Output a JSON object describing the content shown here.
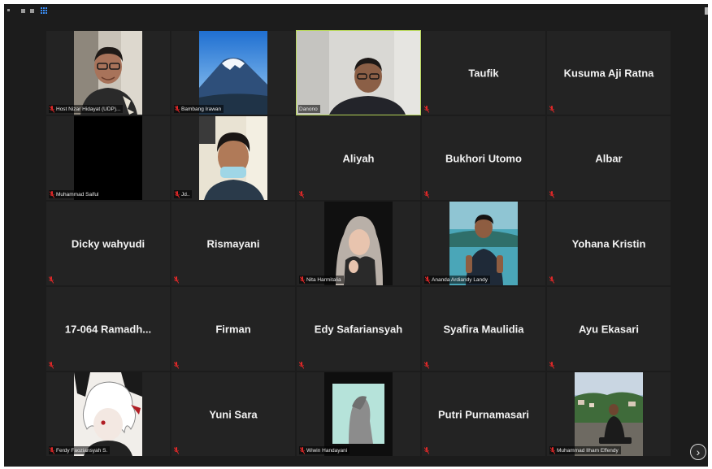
{
  "participants": [
    {
      "name": "Host Nizar Hidayat (UDP)",
      "mode": "video",
      "label": "Host Nizar Hidayat (UDP)..."
    },
    {
      "name": "Bambang Irawan",
      "mode": "video",
      "label": "Bambang Irawan"
    },
    {
      "name": "Danono",
      "mode": "video",
      "label": "Danono",
      "active": true
    },
    {
      "name": "Taufik",
      "mode": "name"
    },
    {
      "name": "Kusuma Aji Ratna",
      "mode": "name"
    },
    {
      "name": "Muhammad Saiful",
      "mode": "video",
      "label": "Muhammad Saiful"
    },
    {
      "name": "Jd..",
      "mode": "video",
      "label": "Jd.."
    },
    {
      "name": "Aliyah",
      "mode": "name"
    },
    {
      "name": "Bukhori Utomo",
      "mode": "name"
    },
    {
      "name": "Albar",
      "mode": "name"
    },
    {
      "name": "Dicky wahyudi",
      "mode": "name"
    },
    {
      "name": "Rismayani",
      "mode": "name"
    },
    {
      "name": "Nita Harmitalia",
      "mode": "video",
      "label": "Nita Harmitalia"
    },
    {
      "name": "Ananda Ardiandy Landy",
      "mode": "video",
      "label": "Ananda Ardiandy Landy"
    },
    {
      "name": "Yohana Kristin",
      "mode": "name"
    },
    {
      "name": "17-064 Ramadh...",
      "mode": "name"
    },
    {
      "name": "Firman",
      "mode": "name"
    },
    {
      "name": "Edy Safariansyah",
      "mode": "name"
    },
    {
      "name": "Syafira Maulidia",
      "mode": "name"
    },
    {
      "name": "Ayu Ekasari",
      "mode": "name"
    },
    {
      "name": "Ferdy Faoziansyah S.",
      "mode": "video",
      "label": "Ferdy Faoziansyah S."
    },
    {
      "name": "Yuni Sara",
      "mode": "name"
    },
    {
      "name": "Wiwin Handayani",
      "mode": "video",
      "label": "Wiwin Handayani"
    },
    {
      "name": "Putri Purnamasari",
      "mode": "name"
    },
    {
      "name": "Muhammad Ilham Effendy",
      "mode": "video",
      "label": "Muhammad Ilham Effendy"
    }
  ],
  "colors": {
    "tile_bg": "#232323",
    "active_outline": "#b7d65b",
    "mic_muted": "#e02828",
    "view_icon": "#3a8df5"
  },
  "icons": {
    "muted": "mic-muted-icon",
    "next": "chevron-right-icon",
    "view": "gallery-view-icon"
  },
  "nav": {
    "next_glyph": "›"
  }
}
